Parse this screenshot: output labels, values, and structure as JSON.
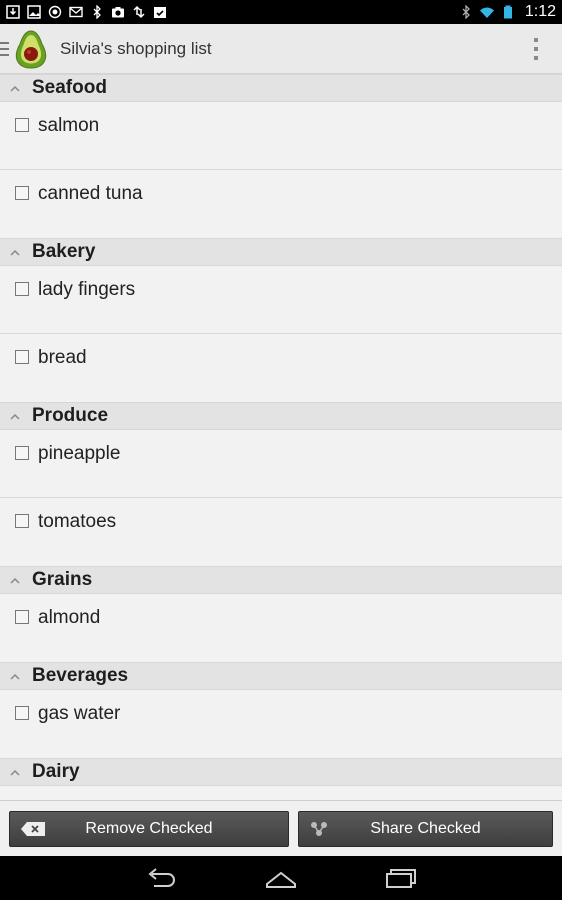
{
  "status_bar": {
    "time": "1:12",
    "left_icons": [
      "download-icon",
      "image-icon",
      "target-icon",
      "gmail-icon",
      "bluetooth-icon",
      "camera-icon",
      "sync-icon",
      "calendar-check-icon"
    ],
    "right_icons": [
      "bluetooth-icon",
      "wifi-icon",
      "battery-icon"
    ]
  },
  "action_bar": {
    "title": "Silvia's shopping list",
    "logo": "avocado-icon",
    "overflow": "overflow-menu-icon"
  },
  "sections": [
    {
      "title": "Seafood",
      "items": [
        {
          "label": "salmon",
          "checked": false
        },
        {
          "label": "canned tuna",
          "checked": false
        }
      ]
    },
    {
      "title": "Bakery",
      "items": [
        {
          "label": "lady fingers",
          "checked": false
        },
        {
          "label": "bread",
          "checked": false
        }
      ]
    },
    {
      "title": "Produce",
      "items": [
        {
          "label": "pineapple",
          "checked": false
        },
        {
          "label": "tomatoes",
          "checked": false
        }
      ]
    },
    {
      "title": "Grains",
      "items": [
        {
          "label": "almond",
          "checked": false
        }
      ]
    },
    {
      "title": "Beverages",
      "items": [
        {
          "label": "gas water",
          "checked": false
        }
      ]
    },
    {
      "title": "Dairy",
      "items": []
    }
  ],
  "buttons": {
    "remove_checked": "Remove Checked",
    "share_checked": "Share Checked"
  },
  "colors": {
    "section_header_bg": "#e3e3e3",
    "item_bg": "#f2f2f2",
    "button_bg": "#4a4a4a",
    "avocado_green": "#8bc34a",
    "avocado_pit": "#8b1a0e"
  }
}
